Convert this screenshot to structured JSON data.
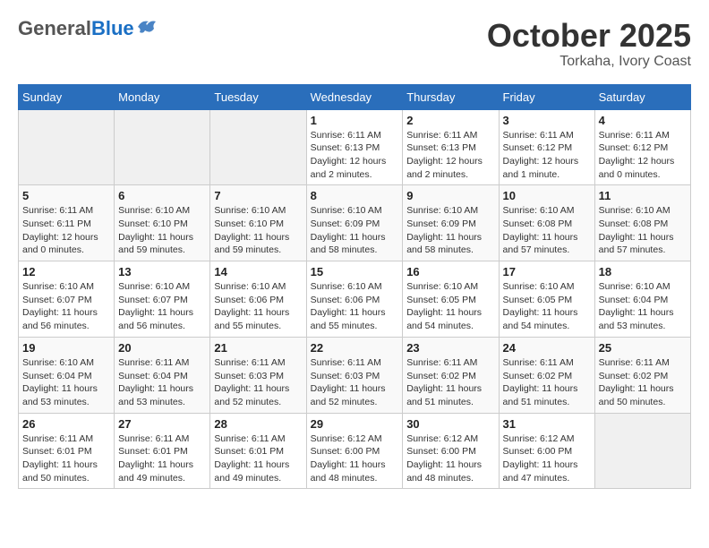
{
  "header": {
    "logo_general": "General",
    "logo_blue": "Blue",
    "month": "October 2025",
    "location": "Torkaha, Ivory Coast"
  },
  "weekdays": [
    "Sunday",
    "Monday",
    "Tuesday",
    "Wednesday",
    "Thursday",
    "Friday",
    "Saturday"
  ],
  "weeks": [
    [
      {
        "day": "",
        "empty": true
      },
      {
        "day": "",
        "empty": true
      },
      {
        "day": "",
        "empty": true
      },
      {
        "day": "1",
        "sunrise": "Sunrise: 6:11 AM",
        "sunset": "Sunset: 6:13 PM",
        "daylight": "Daylight: 12 hours and 2 minutes."
      },
      {
        "day": "2",
        "sunrise": "Sunrise: 6:11 AM",
        "sunset": "Sunset: 6:13 PM",
        "daylight": "Daylight: 12 hours and 2 minutes."
      },
      {
        "day": "3",
        "sunrise": "Sunrise: 6:11 AM",
        "sunset": "Sunset: 6:12 PM",
        "daylight": "Daylight: 12 hours and 1 minute."
      },
      {
        "day": "4",
        "sunrise": "Sunrise: 6:11 AM",
        "sunset": "Sunset: 6:12 PM",
        "daylight": "Daylight: 12 hours and 0 minutes."
      }
    ],
    [
      {
        "day": "5",
        "sunrise": "Sunrise: 6:11 AM",
        "sunset": "Sunset: 6:11 PM",
        "daylight": "Daylight: 12 hours and 0 minutes."
      },
      {
        "day": "6",
        "sunrise": "Sunrise: 6:10 AM",
        "sunset": "Sunset: 6:10 PM",
        "daylight": "Daylight: 11 hours and 59 minutes."
      },
      {
        "day": "7",
        "sunrise": "Sunrise: 6:10 AM",
        "sunset": "Sunset: 6:10 PM",
        "daylight": "Daylight: 11 hours and 59 minutes."
      },
      {
        "day": "8",
        "sunrise": "Sunrise: 6:10 AM",
        "sunset": "Sunset: 6:09 PM",
        "daylight": "Daylight: 11 hours and 58 minutes."
      },
      {
        "day": "9",
        "sunrise": "Sunrise: 6:10 AM",
        "sunset": "Sunset: 6:09 PM",
        "daylight": "Daylight: 11 hours and 58 minutes."
      },
      {
        "day": "10",
        "sunrise": "Sunrise: 6:10 AM",
        "sunset": "Sunset: 6:08 PM",
        "daylight": "Daylight: 11 hours and 57 minutes."
      },
      {
        "day": "11",
        "sunrise": "Sunrise: 6:10 AM",
        "sunset": "Sunset: 6:08 PM",
        "daylight": "Daylight: 11 hours and 57 minutes."
      }
    ],
    [
      {
        "day": "12",
        "sunrise": "Sunrise: 6:10 AM",
        "sunset": "Sunset: 6:07 PM",
        "daylight": "Daylight: 11 hours and 56 minutes."
      },
      {
        "day": "13",
        "sunrise": "Sunrise: 6:10 AM",
        "sunset": "Sunset: 6:07 PM",
        "daylight": "Daylight: 11 hours and 56 minutes."
      },
      {
        "day": "14",
        "sunrise": "Sunrise: 6:10 AM",
        "sunset": "Sunset: 6:06 PM",
        "daylight": "Daylight: 11 hours and 55 minutes."
      },
      {
        "day": "15",
        "sunrise": "Sunrise: 6:10 AM",
        "sunset": "Sunset: 6:06 PM",
        "daylight": "Daylight: 11 hours and 55 minutes."
      },
      {
        "day": "16",
        "sunrise": "Sunrise: 6:10 AM",
        "sunset": "Sunset: 6:05 PM",
        "daylight": "Daylight: 11 hours and 54 minutes."
      },
      {
        "day": "17",
        "sunrise": "Sunrise: 6:10 AM",
        "sunset": "Sunset: 6:05 PM",
        "daylight": "Daylight: 11 hours and 54 minutes."
      },
      {
        "day": "18",
        "sunrise": "Sunrise: 6:10 AM",
        "sunset": "Sunset: 6:04 PM",
        "daylight": "Daylight: 11 hours and 53 minutes."
      }
    ],
    [
      {
        "day": "19",
        "sunrise": "Sunrise: 6:10 AM",
        "sunset": "Sunset: 6:04 PM",
        "daylight": "Daylight: 11 hours and 53 minutes."
      },
      {
        "day": "20",
        "sunrise": "Sunrise: 6:11 AM",
        "sunset": "Sunset: 6:04 PM",
        "daylight": "Daylight: 11 hours and 53 minutes."
      },
      {
        "day": "21",
        "sunrise": "Sunrise: 6:11 AM",
        "sunset": "Sunset: 6:03 PM",
        "daylight": "Daylight: 11 hours and 52 minutes."
      },
      {
        "day": "22",
        "sunrise": "Sunrise: 6:11 AM",
        "sunset": "Sunset: 6:03 PM",
        "daylight": "Daylight: 11 hours and 52 minutes."
      },
      {
        "day": "23",
        "sunrise": "Sunrise: 6:11 AM",
        "sunset": "Sunset: 6:02 PM",
        "daylight": "Daylight: 11 hours and 51 minutes."
      },
      {
        "day": "24",
        "sunrise": "Sunrise: 6:11 AM",
        "sunset": "Sunset: 6:02 PM",
        "daylight": "Daylight: 11 hours and 51 minutes."
      },
      {
        "day": "25",
        "sunrise": "Sunrise: 6:11 AM",
        "sunset": "Sunset: 6:02 PM",
        "daylight": "Daylight: 11 hours and 50 minutes."
      }
    ],
    [
      {
        "day": "26",
        "sunrise": "Sunrise: 6:11 AM",
        "sunset": "Sunset: 6:01 PM",
        "daylight": "Daylight: 11 hours and 50 minutes."
      },
      {
        "day": "27",
        "sunrise": "Sunrise: 6:11 AM",
        "sunset": "Sunset: 6:01 PM",
        "daylight": "Daylight: 11 hours and 49 minutes."
      },
      {
        "day": "28",
        "sunrise": "Sunrise: 6:11 AM",
        "sunset": "Sunset: 6:01 PM",
        "daylight": "Daylight: 11 hours and 49 minutes."
      },
      {
        "day": "29",
        "sunrise": "Sunrise: 6:12 AM",
        "sunset": "Sunset: 6:00 PM",
        "daylight": "Daylight: 11 hours and 48 minutes."
      },
      {
        "day": "30",
        "sunrise": "Sunrise: 6:12 AM",
        "sunset": "Sunset: 6:00 PM",
        "daylight": "Daylight: 11 hours and 48 minutes."
      },
      {
        "day": "31",
        "sunrise": "Sunrise: 6:12 AM",
        "sunset": "Sunset: 6:00 PM",
        "daylight": "Daylight: 11 hours and 47 minutes."
      },
      {
        "day": "",
        "empty": true
      }
    ]
  ]
}
